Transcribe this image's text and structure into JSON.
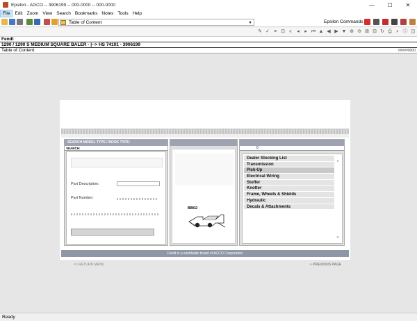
{
  "window": {
    "title": "Epsilon - AGCO -- 3906199 -- 000-0000 -- 000-0000",
    "minimize": "—",
    "maximize": "☐",
    "close": "✕"
  },
  "menu": [
    "File",
    "Edit",
    "Zoom",
    "View",
    "Search",
    "Bookmarks",
    "Notes",
    "Tools",
    "Help"
  ],
  "toolbar": {
    "toc_combo": "Table of Content",
    "combo_arrow": "▾",
    "commands_label": "Epsilon Commands -->"
  },
  "info": {
    "brand": "Fendt",
    "model": "1290 / 1290 S  MEDIUM SQUARE BALER  -  |--> HS 74101 - 3906199",
    "section": "Table of Content",
    "section_right": "#####0000"
  },
  "panel": {
    "col1_header": "SEARCH MODEL TYPE / BOOK TYPE:",
    "search_label": "SEARCH:",
    "part_description": "Part Description:",
    "part_number": "Part Number:",
    "col3_code": "0",
    "baler_model": "BB02",
    "categories": [
      "Dealer Stocking List",
      "Transmission",
      "Pick-Up",
      "Electrical Wiring",
      "Stuffer",
      "Knotter",
      "Frame, Wheels & Shields",
      "Hydraulic",
      "Decals & Attachments"
    ],
    "selected_category": 2,
    "scroll_up": "⌃",
    "scroll_down": "⌄",
    "footer": "Fendt is a worldwide brand of AGCO Corporation",
    "nav_main": "<< RETURN MENU",
    "nav_prev": "«  PREVIOUS PAGE"
  },
  "status": "Ready",
  "colors": {
    "pane_header": "#9da3b2",
    "footer_bar": "#8f96a6",
    "selected_item": "#c8c8c8"
  }
}
